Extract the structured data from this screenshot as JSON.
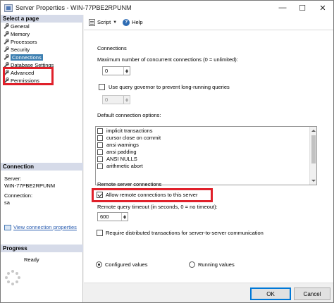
{
  "window": {
    "title": "Server Properties - WIN-77PBE2RPUNM",
    "controls": [
      "—",
      "☐",
      "✕"
    ]
  },
  "left": {
    "select_page_header": "Select a page",
    "pages": [
      {
        "label": "General",
        "selected": false
      },
      {
        "label": "Memory",
        "selected": false
      },
      {
        "label": "Processors",
        "selected": false
      },
      {
        "label": "Security",
        "selected": false
      },
      {
        "label": "Connections",
        "selected": true
      },
      {
        "label": "Database Settings",
        "selected": false
      },
      {
        "label": "Advanced",
        "selected": false
      },
      {
        "label": "Permissions",
        "selected": false
      }
    ],
    "connection_header": "Connection",
    "server_label": "Server:",
    "server_value": "WIN-77PBE2RPUNM",
    "connection_label": "Connection:",
    "connection_value": "sa",
    "view_connection_properties": "View connection properties",
    "progress_header": "Progress",
    "progress_status": "Ready"
  },
  "toolbar": {
    "script_label": "Script",
    "help_label": "Help"
  },
  "connections": {
    "section_title": "Connections",
    "max_connections_label": "Maximum number of concurrent connections (0 = unlimited):",
    "max_connections_value": "0",
    "query_governor_label": "Use query governor to prevent long-running queries",
    "query_governor_checked": false,
    "query_governor_value": "0",
    "default_options_label": "Default connection options:",
    "default_options": [
      "implicit transactions",
      "cursor close on commit",
      "ansi warnings",
      "ansi padding",
      "ANSI NULLS",
      "arithmetic abort"
    ],
    "remote_section_title": "Remote server connections",
    "allow_remote_label": "Allow remote connections to this server",
    "allow_remote_checked": true,
    "remote_timeout_label": "Remote query timeout (in seconds, 0 = no timeout):",
    "remote_timeout_value": "600",
    "distributed_tx_label": "Require distributed transactions for server-to-server communication",
    "distributed_tx_checked": false,
    "configured_values_label": "Configured values",
    "running_values_label": "Running values",
    "selected_view": "Configured values"
  },
  "footer": {
    "ok_label": "OK",
    "cancel_label": "Cancel"
  }
}
